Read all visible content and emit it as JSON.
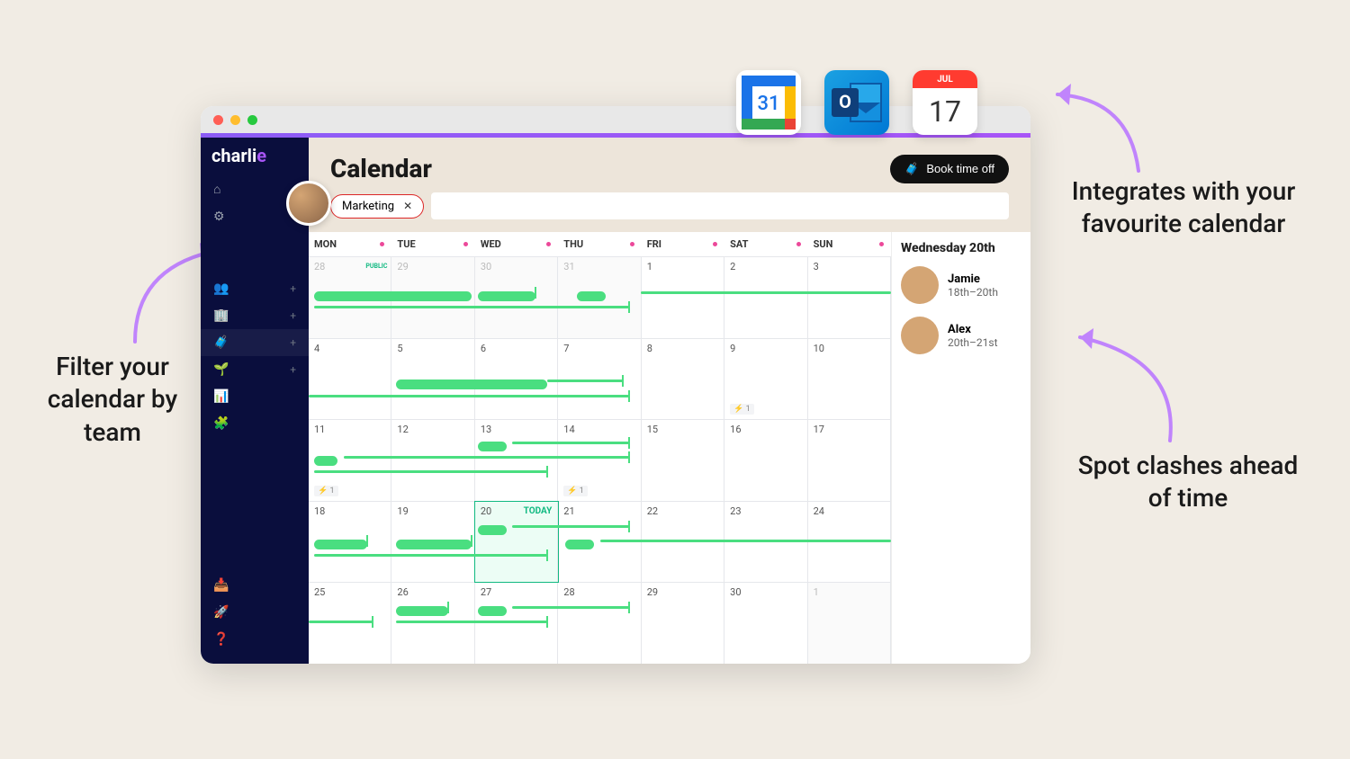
{
  "annotations": {
    "left": "Filter your calendar by team",
    "right_top": "Integrates with your favourite calendar",
    "right_bot": "Spot clashes ahead of time"
  },
  "brand": {
    "name": "charlie"
  },
  "header": {
    "title": "Calendar",
    "book_button": "Book time off"
  },
  "filter": {
    "chip": "Marketing"
  },
  "days": [
    "MON",
    "TUE",
    "WED",
    "THU",
    "FRI",
    "SAT",
    "SUN"
  ],
  "weeks": [
    [
      {
        "n": "28",
        "out": true,
        "public": true
      },
      {
        "n": "29",
        "out": true
      },
      {
        "n": "30",
        "out": true
      },
      {
        "n": "31",
        "out": true
      },
      {
        "n": "1"
      },
      {
        "n": "2"
      },
      {
        "n": "3"
      }
    ],
    [
      {
        "n": "4"
      },
      {
        "n": "5"
      },
      {
        "n": "6"
      },
      {
        "n": "7"
      },
      {
        "n": "8"
      },
      {
        "n": "9",
        "badge": "1"
      },
      {
        "n": "10"
      }
    ],
    [
      {
        "n": "11",
        "badge": "1"
      },
      {
        "n": "12"
      },
      {
        "n": "13"
      },
      {
        "n": "14",
        "badge": "1"
      },
      {
        "n": "15"
      },
      {
        "n": "16"
      },
      {
        "n": "17"
      }
    ],
    [
      {
        "n": "18"
      },
      {
        "n": "19"
      },
      {
        "n": "20",
        "today": true
      },
      {
        "n": "21"
      },
      {
        "n": "22"
      },
      {
        "n": "23"
      },
      {
        "n": "24"
      }
    ],
    [
      {
        "n": "25"
      },
      {
        "n": "26"
      },
      {
        "n": "27"
      },
      {
        "n": "28"
      },
      {
        "n": "29"
      },
      {
        "n": "30"
      },
      {
        "n": "1",
        "out": true
      }
    ]
  ],
  "today_label": "TODAY",
  "public_label": "PUBLIC",
  "sidepanel": {
    "title": "Wednesday 20th",
    "people": [
      {
        "name": "Jamie",
        "dates": "18th–20th"
      },
      {
        "name": "Alex",
        "dates": "20th–21st"
      }
    ]
  },
  "integrations": {
    "apple_month": "JUL",
    "apple_day": "17",
    "google_day": "31"
  }
}
